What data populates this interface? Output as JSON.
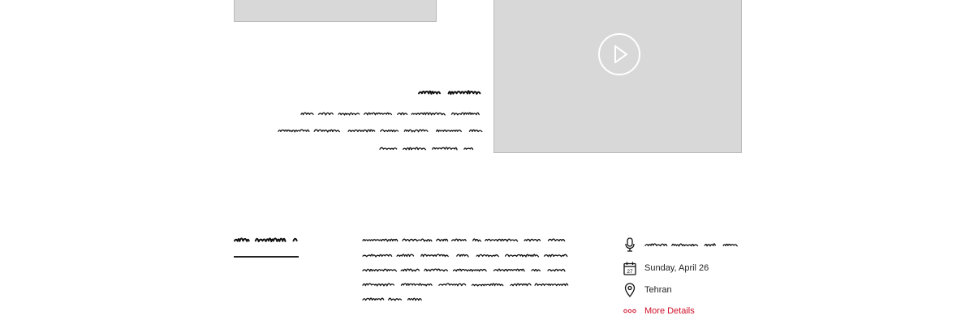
{
  "details": {
    "date": "Sunday, April 26",
    "location": "Tehran",
    "more_label": "More Details",
    "calendar_day": "27",
    "accent_color": "#d0112b"
  },
  "icons": {
    "play": "play-icon",
    "microphone": "microphone-icon",
    "calendar": "calendar-icon",
    "location": "location-pin-icon",
    "more": "more-dots-icon"
  }
}
